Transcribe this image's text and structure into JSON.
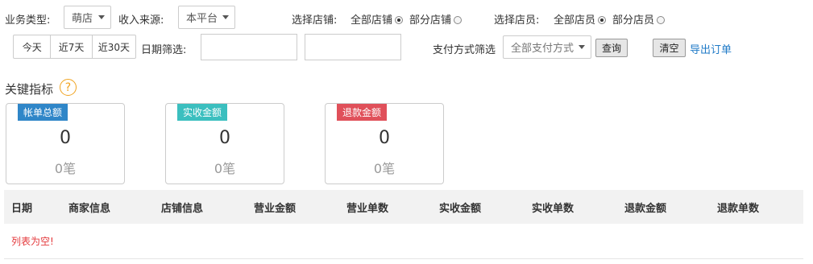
{
  "filters": {
    "business_type_label": "业务类型:",
    "business_type_value": "萌店",
    "income_source_label": "收入来源:",
    "income_source_value": "本平台",
    "store_label": "选择店铺:",
    "store_all": "全部店铺",
    "store_partial": "部分店铺",
    "staff_label": "选择店员:",
    "staff_all": "全部店员",
    "staff_partial": "部分店员",
    "today": "今天",
    "last7": "近7天",
    "last30": "近30天",
    "date_label": "日期筛选:",
    "date_start": "",
    "date_end": "",
    "payment_label": "支付方式筛选",
    "payment_value": "全部支付方式",
    "query": "查询",
    "clear": "清空",
    "export": "导出订单"
  },
  "kpi": {
    "title": "关键指标",
    "help": "?",
    "cards": [
      {
        "tag": "帐单总额",
        "value": "0",
        "count": "0笔",
        "color": "#2f86c8"
      },
      {
        "tag": "实收金额",
        "value": "0",
        "count": "0笔",
        "color": "#3bbfbf"
      },
      {
        "tag": "退款金额",
        "value": "0",
        "count": "0笔",
        "color": "#e0505a"
      }
    ]
  },
  "table": {
    "columns": [
      "日期",
      "商家信息",
      "店铺信息",
      "营业金额",
      "营业单数",
      "实收金额",
      "实收单数",
      "退款金额",
      "退款单数"
    ],
    "empty_text": "列表为空!"
  }
}
